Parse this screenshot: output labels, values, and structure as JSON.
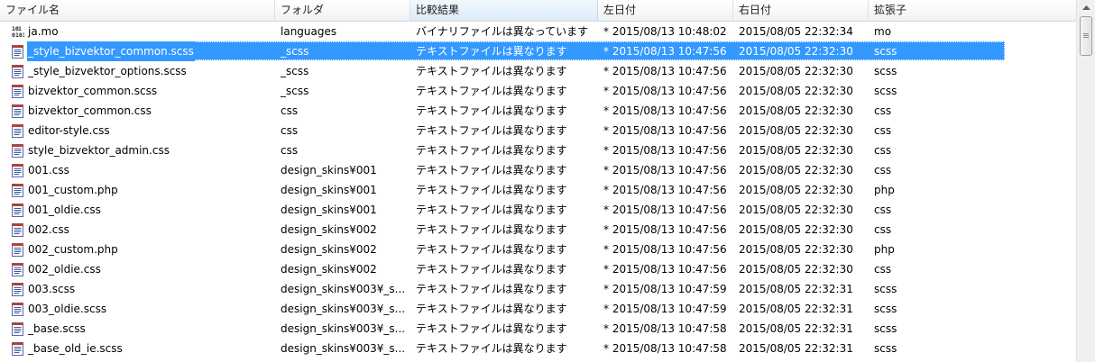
{
  "columns": [
    {
      "label": "ファイル名"
    },
    {
      "label": "フォルダ"
    },
    {
      "label": "比較結果"
    },
    {
      "label": "左日付"
    },
    {
      "label": "右日付"
    },
    {
      "label": "拡張子"
    }
  ],
  "rows": [
    {
      "name": "ja.mo",
      "folder": "languages",
      "result": "バイナリファイルは異なっています",
      "left": "* 2015/08/13 10:48:02",
      "right": "2015/08/05 22:32:34",
      "ext": "mo",
      "icon": "binary-file-icon"
    },
    {
      "name": "_style_bizvektor_common.scss",
      "folder": "_scss",
      "result": "テキストファイルは異なります",
      "left": "* 2015/08/13 10:47:56",
      "right": "2015/08/05 22:32:30",
      "ext": "scss",
      "icon": "text-file-icon"
    },
    {
      "name": "_style_bizvektor_options.scss",
      "folder": "_scss",
      "result": "テキストファイルは異なります",
      "left": "* 2015/08/13 10:47:56",
      "right": "2015/08/05 22:32:30",
      "ext": "scss",
      "icon": "text-file-icon"
    },
    {
      "name": "bizvektor_common.scss",
      "folder": "_scss",
      "result": "テキストファイルは異なります",
      "left": "* 2015/08/13 10:47:56",
      "right": "2015/08/05 22:32:30",
      "ext": "scss",
      "icon": "text-file-icon"
    },
    {
      "name": "bizvektor_common.css",
      "folder": "css",
      "result": "テキストファイルは異なります",
      "left": "* 2015/08/13 10:47:56",
      "right": "2015/08/05 22:32:30",
      "ext": "css",
      "icon": "text-file-icon"
    },
    {
      "name": "editor-style.css",
      "folder": "css",
      "result": "テキストファイルは異なります",
      "left": "* 2015/08/13 10:47:56",
      "right": "2015/08/05 22:32:30",
      "ext": "css",
      "icon": "text-file-icon"
    },
    {
      "name": "style_bizvektor_admin.css",
      "folder": "css",
      "result": "テキストファイルは異なります",
      "left": "* 2015/08/13 10:47:56",
      "right": "2015/08/05 22:32:30",
      "ext": "css",
      "icon": "text-file-icon"
    },
    {
      "name": "001.css",
      "folder": "design_skins¥001",
      "result": "テキストファイルは異なります",
      "left": "* 2015/08/13 10:47:56",
      "right": "2015/08/05 22:32:30",
      "ext": "css",
      "icon": "text-file-icon"
    },
    {
      "name": "001_custom.php",
      "folder": "design_skins¥001",
      "result": "テキストファイルは異なります",
      "left": "* 2015/08/13 10:47:56",
      "right": "2015/08/05 22:32:30",
      "ext": "php",
      "icon": "text-file-icon"
    },
    {
      "name": "001_oldie.css",
      "folder": "design_skins¥001",
      "result": "テキストファイルは異なります",
      "left": "* 2015/08/13 10:47:56",
      "right": "2015/08/05 22:32:30",
      "ext": "css",
      "icon": "text-file-icon"
    },
    {
      "name": "002.css",
      "folder": "design_skins¥002",
      "result": "テキストファイルは異なります",
      "left": "* 2015/08/13 10:47:56",
      "right": "2015/08/05 22:32:30",
      "ext": "css",
      "icon": "text-file-icon"
    },
    {
      "name": "002_custom.php",
      "folder": "design_skins¥002",
      "result": "テキストファイルは異なります",
      "left": "* 2015/08/13 10:47:56",
      "right": "2015/08/05 22:32:30",
      "ext": "php",
      "icon": "text-file-icon"
    },
    {
      "name": "002_oldie.css",
      "folder": "design_skins¥002",
      "result": "テキストファイルは異なります",
      "left": "* 2015/08/13 10:47:56",
      "right": "2015/08/05 22:32:30",
      "ext": "css",
      "icon": "text-file-icon"
    },
    {
      "name": "003.scss",
      "folder": "design_skins¥003¥_s...",
      "result": "テキストファイルは異なります",
      "left": "* 2015/08/13 10:47:59",
      "right": "2015/08/05 22:32:31",
      "ext": "scss",
      "icon": "text-file-icon"
    },
    {
      "name": "003_oldie.scss",
      "folder": "design_skins¥003¥_s...",
      "result": "テキストファイルは異なります",
      "left": "* 2015/08/13 10:47:59",
      "right": "2015/08/05 22:32:31",
      "ext": "scss",
      "icon": "text-file-icon"
    },
    {
      "name": "_base.scss",
      "folder": "design_skins¥003¥_s...",
      "result": "テキストファイルは異なります",
      "left": "* 2015/08/13 10:47:58",
      "right": "2015/08/05 22:32:31",
      "ext": "scss",
      "icon": "text-file-icon"
    },
    {
      "name": "_base_old_ie.scss",
      "folder": "design_skins¥003¥_s...",
      "result": "テキストファイルは異なります",
      "left": "* 2015/08/13 10:47:58",
      "right": "2015/08/05 22:32:31",
      "ext": "scss",
      "icon": "text-file-icon"
    }
  ],
  "selected_row": 1,
  "sorted_column": 2,
  "colors": {
    "selection": "#3399ff",
    "header_bg": "#f1f2f4"
  }
}
